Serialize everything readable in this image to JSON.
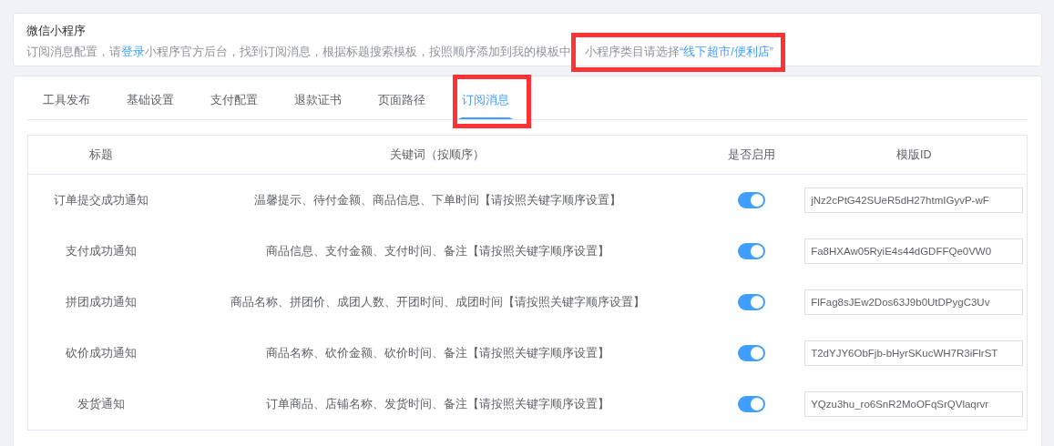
{
  "header": {
    "title": "微信小程序",
    "description": {
      "before": "订阅消息配置，请",
      "link": "登录",
      "after": "小程序官方后台，找到订阅消息，根据标题搜索模板，按照顺序添加到我的模板中",
      "note": {
        "highlighted": true,
        "text": "小程序类目请选择",
        "link": "“线下超市/便利店”"
      }
    }
  },
  "tabs": [
    {
      "label": "工具发布",
      "selected": false,
      "highlighted": false
    },
    {
      "label": "基础设置",
      "selected": false,
      "highlighted": false
    },
    {
      "label": "支付配置",
      "selected": false,
      "highlighted": false
    },
    {
      "label": "退款证书",
      "selected": false,
      "highlighted": false
    },
    {
      "label": "页面路径",
      "selected": false,
      "highlighted": false
    },
    {
      "label": "订阅消息",
      "selected": true,
      "highlighted": true
    }
  ],
  "table": {
    "columns": [
      "标题",
      "关键词（按顺序）",
      "是否启用",
      "模版ID"
    ],
    "rows": [
      {
        "title": "订单提交成功通知",
        "keywords": "温馨提示、待付金额、商品信息、下单时间【请按照关键字顺序设置】",
        "enabled": true,
        "template_id": "jNz2cPtG42SUeR5dH27htmIGyvP-wF"
      },
      {
        "title": "支付成功通知",
        "keywords": "商品信息、支付金额、支付时间、备注【请按照关键字顺序设置】",
        "enabled": true,
        "template_id": "Fa8HXAw05RyiE4s44dGDFFQe0VW0"
      },
      {
        "title": "拼团成功通知",
        "keywords": "商品名称、拼团价、成团人数、开团时间、成团时间【请按照关键字顺序设置】",
        "enabled": true,
        "template_id": "FlFag8sJEw2Dos63J9b0UtDPygC3Uv"
      },
      {
        "title": "砍价成功通知",
        "keywords": "商品名称、砍价金额、砍价时间、备注【请按照关键字顺序设置】",
        "enabled": true,
        "template_id": "T2dYJY6ObFjb-bHyrSKucWH7R3iFlrST"
      },
      {
        "title": "发货通知",
        "keywords": "订单商品、店铺名称、发货时间、备注【请按照关键字顺序设置】",
        "enabled": true,
        "template_id": "YQzu3hu_ro6SnR2MoOFqSrQVlaqrvr"
      }
    ]
  }
}
